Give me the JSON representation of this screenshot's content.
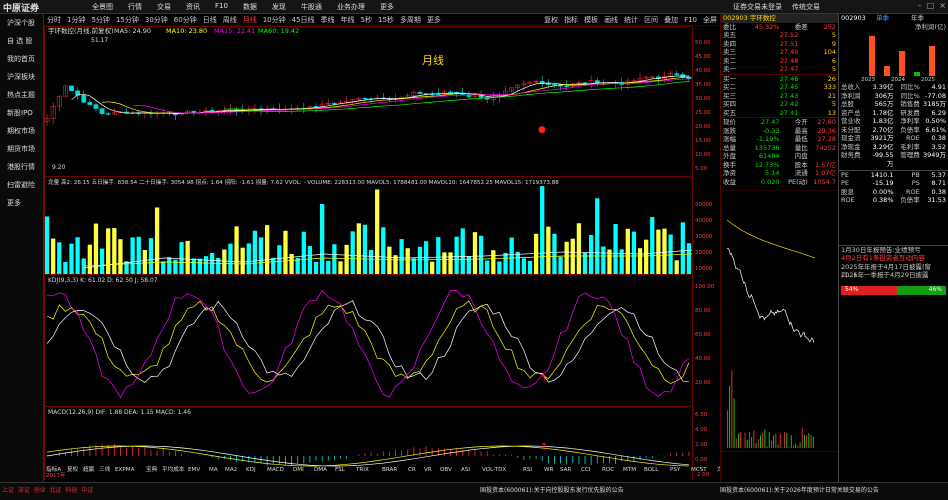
{
  "app": {
    "logo": "中原证券",
    "menu": [
      "全景图",
      "行情",
      "交易",
      "资讯",
      "F10",
      "数据",
      "发现",
      "牛股通",
      "业务办理",
      "更多"
    ],
    "top_right": [
      "证券交易未登录",
      "传统交易"
    ]
  },
  "sidebar": [
    "沪深个股",
    "自 选 股",
    "我的首页",
    "沪深板块",
    "热点主题",
    "新股IPO",
    "期权市场",
    "期货市场",
    "港股行情",
    "扫雷避险",
    "更多"
  ],
  "toolbar": {
    "periods": [
      "分时",
      "1分钟",
      "5分钟",
      "15分钟",
      "30分钟",
      "60分钟",
      "日线",
      "周线",
      "月线",
      "10分钟",
      "45日线",
      "季线",
      "年线",
      "5秒",
      "15秒",
      "多周期",
      "更多"
    ],
    "right": [
      "复权",
      "指标",
      "模板",
      "画线",
      "统计",
      "区间",
      "叠加",
      "F10",
      "全屏"
    ]
  },
  "chart": {
    "stock_line": "宇环数控(月线,前复权)",
    "ma5": "MA5: 24.90",
    "ma10": "MA10: 23.80",
    "ma15": "MA15: 22.41",
    "ma60": "MA60: 19.42",
    "max": "51.17",
    "min": "9.20",
    "label": "月线",
    "ind1": "龙量  高2: 26.15  五日操手: 838.54  二十日操手: 3054.98  拐点: 1.64  拐阳: -1.61  拐量: 7.62  VVOL: - VOLUME: 228313.00  MAVOL5: 1788481.00  MAVOL10: 1647852.25  MAVOL15: 1719373.88",
    "ind2": "KDJ(9,3,3)  K: 61.02  D: 62.50  J: 58.07",
    "ind3": "MACD(12,26,9)  DIF: 1.88  DEA: 1.15  MACD: 1.46",
    "price_axis": [
      "50.00",
      "45.00",
      "40.00",
      "35.00",
      "30.00",
      "25.00",
      "20.00",
      "15.00",
      "10.00",
      "5.00"
    ],
    "vol_axis": [
      "50000",
      "40000",
      "30000",
      "20000",
      "10000"
    ],
    "kdj_axis": [
      "100.00",
      "80.00",
      "60.00",
      "40.00",
      "20.00"
    ],
    "macd_axis": [
      "6.00",
      "4.00",
      "2.00",
      "0.00",
      "-2.00"
    ],
    "year_start": "2017年",
    "bottom_tabs": [
      "指标A",
      "复权",
      "超赢",
      "三线",
      "EXPMA",
      "宝典",
      "平均成本",
      "EMV",
      "MA",
      "MA2",
      "KDJ",
      "MACD",
      "DMI",
      "DMA",
      "FSL",
      "TRIX",
      "BRAR",
      "CR",
      "VR",
      "OBV",
      "ASI",
      "VOL-TDX",
      "RSI",
      "WR",
      "SAR",
      "CCI",
      "ROC",
      "MTM",
      "BOLL",
      "PSY",
      "MCST",
      "龙线",
      "资金",
      "指标B",
      "设置"
    ]
  },
  "quote": {
    "code": "002903 宇环数控",
    "webi": "45.32%",
    "wc": "252",
    "asks": [
      [
        "卖五",
        "27.52",
        "5"
      ],
      [
        "卖四",
        "27.51",
        "9"
      ],
      [
        "卖三",
        "27.49",
        "104"
      ],
      [
        "卖二",
        "27.48",
        "6"
      ],
      [
        "卖一",
        "27.47",
        "5"
      ]
    ],
    "bids": [
      [
        "买一",
        "27.46",
        "26"
      ],
      [
        "买二",
        "27.45",
        "333"
      ],
      [
        "买三",
        "27.43",
        "21"
      ],
      [
        "买四",
        "27.42",
        "5"
      ],
      [
        "买五",
        "27.41",
        "13"
      ]
    ],
    "stats": [
      [
        "现价",
        "27.47",
        "今开",
        "27.80"
      ],
      [
        "涨跌",
        "-0.33",
        "最高",
        "29.36"
      ],
      [
        "涨幅",
        "-1.19%",
        "最低",
        "27.28"
      ],
      [
        "总量",
        "135736",
        "量比",
        "74252"
      ],
      [
        "外盘",
        "61484",
        "内盘",
        ""
      ],
      [
        "换手",
        "12.73%",
        "股本",
        "1.57亿"
      ],
      [
        "净资",
        "5.14",
        "流通",
        "1.07亿"
      ],
      [
        "收益",
        "0.020",
        "PE(动)",
        "1054.7"
      ]
    ]
  },
  "far": {
    "code": "002903",
    "tabs": [
      "单季",
      "年季",
      "净利润(亿)"
    ],
    "years": [
      "2023",
      "2024",
      "2025"
    ],
    "rows": [
      [
        "总收入",
        "3.39亿",
        "同比%",
        "4.91"
      ],
      [
        "净利润",
        "306万",
        "同比%",
        "-77.08"
      ],
      [
        "总股",
        "565万",
        "销售费",
        "3185万"
      ],
      [
        "资产总",
        "1.78亿",
        "研发费",
        "6.29"
      ],
      [
        "营业收",
        "1.83亿",
        "净利率",
        "0.50%"
      ],
      [
        "未分配",
        "2.70亿",
        "负债率",
        "6.61%"
      ],
      [
        "现金流",
        "3921万",
        "ROE",
        "0.38"
      ],
      [
        "净现金",
        "3.29亿",
        "毛利率",
        "3.52"
      ],
      [
        "财务费",
        "-99.55万",
        "管理费",
        "3949万"
      ]
    ],
    "rows2": [
      [
        "PE",
        "1410.1",
        "PB",
        "5.37"
      ],
      [
        "PE",
        "-15.19",
        "PS",
        "8.71"
      ],
      [
        "股息",
        "0.00%",
        "ROE",
        "0.38"
      ],
      [
        "ROE",
        "0.38%",
        "负债率",
        "31.53"
      ]
    ],
    "news": [
      "1月30日年报预告:业绩预亏",
      "4月2日有1条投资者互动内容",
      "2025年年报于4月17日披露(窗口...)",
      "2026年一季报于4月29日披露"
    ],
    "sentiment": {
      "up": "54%",
      "down": "46%"
    }
  },
  "bottom": {
    "items": [
      "上证",
      "深证",
      "创业",
      "北证",
      "科创",
      "中证"
    ],
    "ticker": "国投资本(600061):关于向控股股东发行优先股的公告",
    "right_news": "国投资本(600061):关于2026年度预计日常关联交易的公告"
  }
}
